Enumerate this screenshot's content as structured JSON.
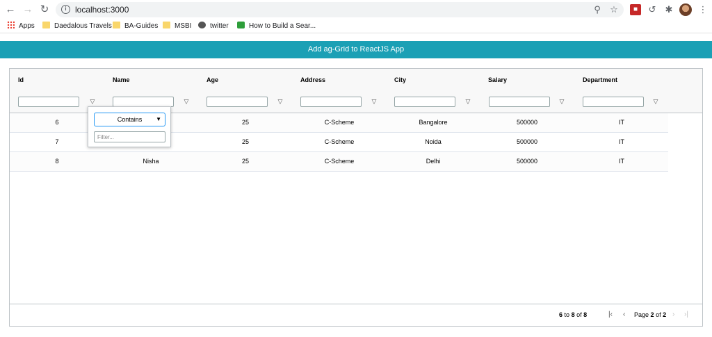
{
  "browser": {
    "url": "localhost:3000",
    "bookmarks": [
      {
        "label": "Apps",
        "icon": "apps-grid-icon"
      },
      {
        "label": "Daedalous Travels",
        "icon": "folder-icon"
      },
      {
        "label": "BA-Guides",
        "icon": "folder-icon"
      },
      {
        "label": "MSBI",
        "icon": "folder-icon"
      },
      {
        "label": "twitter",
        "icon": "globe-icon"
      },
      {
        "label": "How to Build a Sear...",
        "icon": "site-icon"
      }
    ]
  },
  "app": {
    "title": "Add ag-Grid to ReactJS App",
    "accent_color": "#1ba0b5"
  },
  "grid": {
    "columns": [
      "Id",
      "Name",
      "Age",
      "Address",
      "City",
      "Salary",
      "Department"
    ],
    "rows": [
      [
        "6",
        "",
        "25",
        "C-Scheme",
        "Bangalore",
        "500000",
        "IT"
      ],
      [
        "7",
        "",
        "25",
        "C-Scheme",
        "Noida",
        "500000",
        "IT"
      ],
      [
        "8",
        "Nisha",
        "25",
        "C-Scheme",
        "Delhi",
        "500000",
        "IT"
      ]
    ],
    "filter_popup": {
      "condition": "Contains",
      "placeholder": "Filter..."
    },
    "pager": {
      "from": "6",
      "to_word": "to",
      "to": "8",
      "of_word": "of",
      "total": "8",
      "page_word": "Page",
      "page": "2",
      "page_of_word": "of",
      "page_total": "2"
    }
  }
}
